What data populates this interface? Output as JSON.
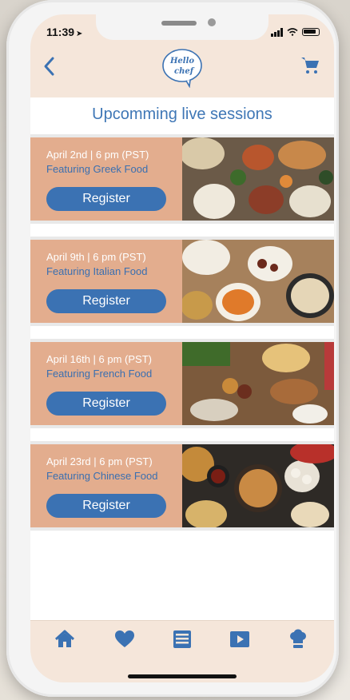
{
  "status": {
    "time": "11:39"
  },
  "header": {
    "logo_text_1": "Hello",
    "logo_text_2": "chef"
  },
  "page": {
    "title": "Upcomming live sessions"
  },
  "sessions": [
    {
      "date": "April 2nd | 6 pm (PST)",
      "feature": "Featuring Greek Food",
      "button": "Register"
    },
    {
      "date": "April 9th | 6 pm (PST)",
      "feature": "Featuring Italian Food",
      "button": "Register"
    },
    {
      "date": "April 16th | 6 pm (PST)",
      "feature": "Featuring French Food",
      "button": "Register"
    },
    {
      "date": "April 23rd | 6 pm (PST)",
      "feature": "Featuring Chinese Food",
      "button": "Register"
    }
  ],
  "tabs": [
    "home-icon",
    "heart-icon",
    "list-icon",
    "play-icon",
    "chef-hat-icon"
  ],
  "colors": {
    "accent": "#3b72b3",
    "header_bg": "#f5e6da",
    "card_bg": "#e3ad8e"
  }
}
